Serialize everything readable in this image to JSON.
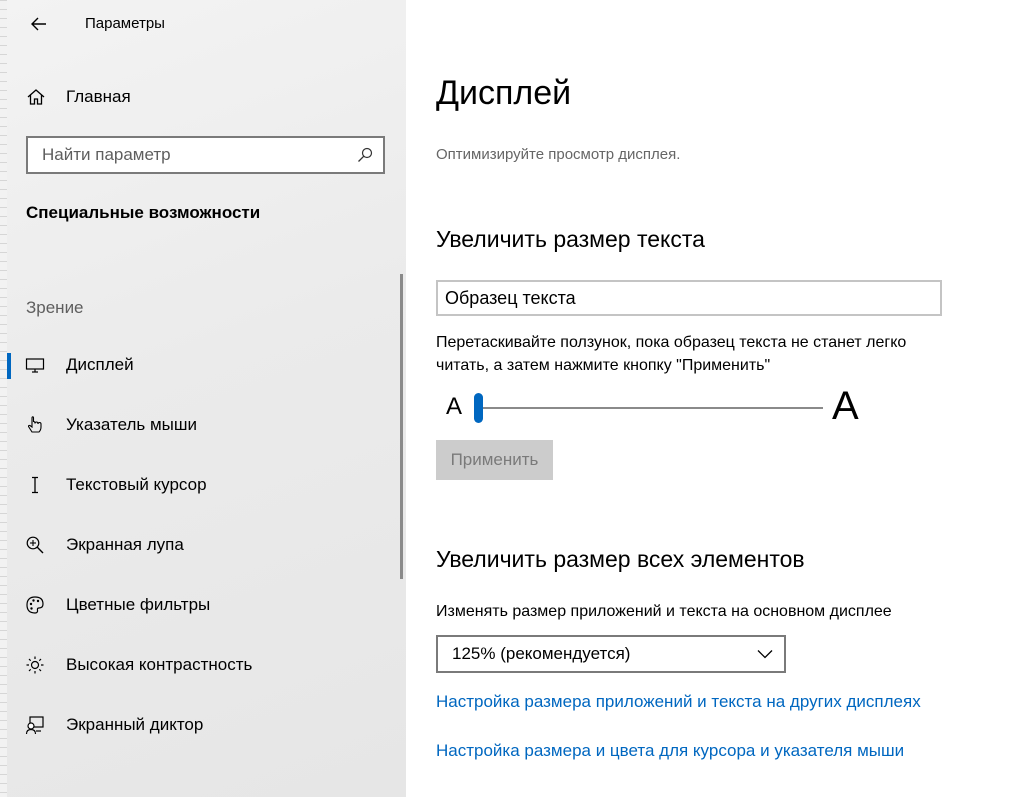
{
  "window": {
    "title": "Параметры"
  },
  "sidebar": {
    "home_label": "Главная",
    "search_placeholder": "Найти параметр",
    "section_title": "Специальные возможности",
    "group_label": "Зрение",
    "items": [
      {
        "label": "Дисплей",
        "icon": "display-icon",
        "active": true
      },
      {
        "label": "Указатель мыши",
        "icon": "mouse-pointer-icon"
      },
      {
        "label": "Текстовый курсор",
        "icon": "text-cursor-icon"
      },
      {
        "label": "Экранная лупа",
        "icon": "magnifier-icon"
      },
      {
        "label": "Цветные фильтры",
        "icon": "palette-icon"
      },
      {
        "label": "Высокая контрастность",
        "icon": "brightness-icon"
      },
      {
        "label": "Экранный диктор",
        "icon": "narrator-icon"
      }
    ]
  },
  "main": {
    "title": "Дисплей",
    "subtitle": "Оптимизируйте просмотр дисплея.",
    "text_size": {
      "heading": "Увеличить размер текста",
      "sample_text": "Образец текста",
      "description": "Перетаскивайте ползунок, пока образец текста не станет легко читать, а затем нажмите кнопку \"Применить\"",
      "slider_min_label": "A",
      "slider_max_label": "A",
      "slider_value_percent": 0,
      "apply_label": "Применить"
    },
    "scale": {
      "heading": "Увеличить размер всех элементов",
      "label": "Изменять размер приложений и текста на основном дисплее",
      "selected": "125% (рекомендуется)"
    },
    "links": [
      "Настройка размера приложений и текста на других дисплеях",
      "Настройка размера и цвета для курсора и указателя мыши"
    ]
  },
  "colors": {
    "accent": "#0067c0",
    "sidebar_bg": "#eeeeee",
    "disabled_button": "#cccccc"
  }
}
